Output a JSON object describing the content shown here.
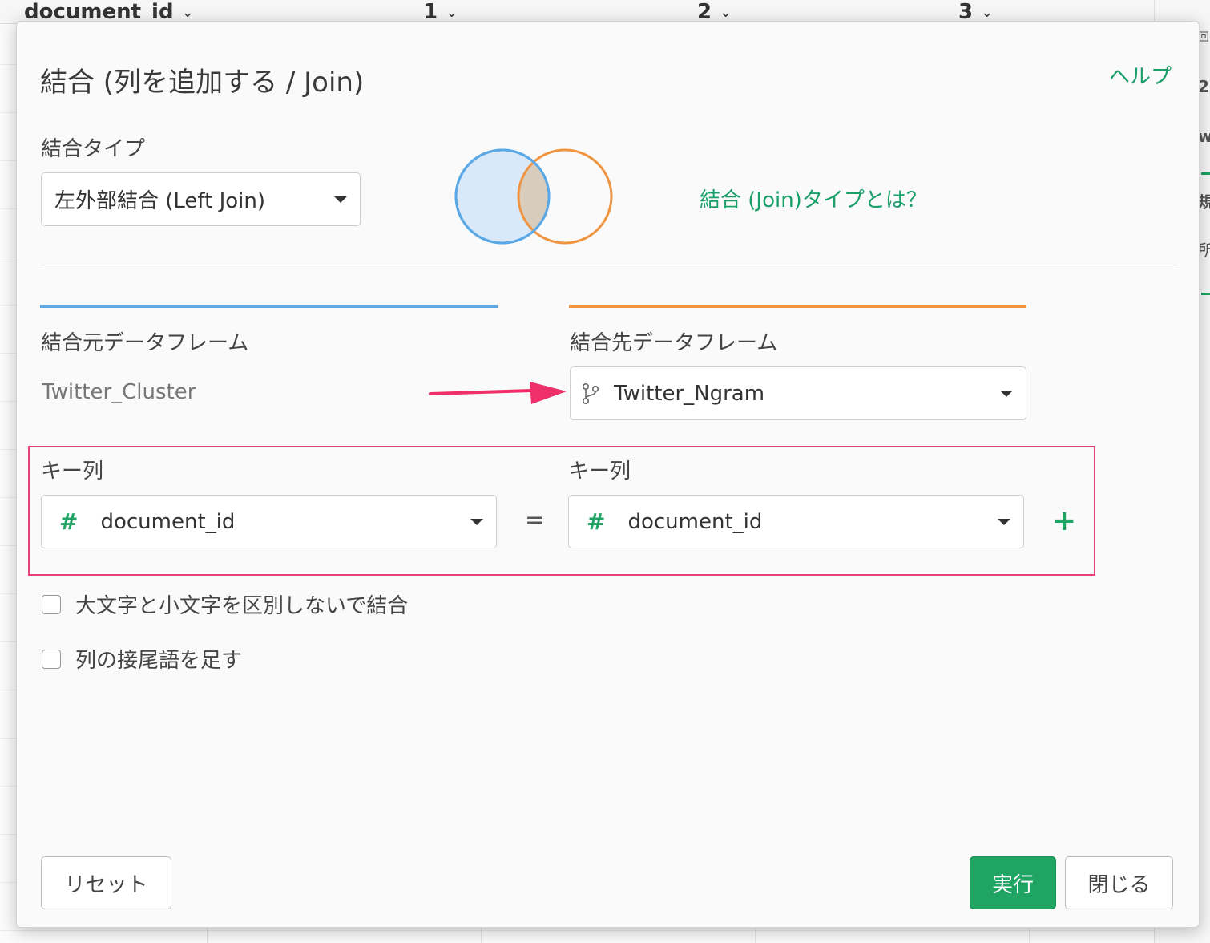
{
  "background": {
    "columns": [
      {
        "label": "document_id"
      },
      {
        "label": "1"
      },
      {
        "label": "2"
      },
      {
        "label": "3"
      }
    ],
    "side_glyphs": [
      "回",
      "2.",
      "w",
      "規",
      "所"
    ]
  },
  "dialog": {
    "title": "結合 (列を追加する / Join)",
    "help_label": "ヘルプ",
    "join_type": {
      "label": "結合タイプ",
      "selected": "左外部結合 (Left Join)",
      "what_is_link": "結合 (Join)タイプとは？",
      "venn_colors": {
        "left": "#5aa9e6",
        "right": "#ef9440"
      }
    },
    "source": {
      "label": "結合元データフレーム",
      "value": "Twitter_Cluster",
      "color": "#5aa9e6"
    },
    "target": {
      "label": "結合先データフレーム",
      "selected": "Twitter_Ngram",
      "icon": "branch-icon",
      "color": "#ef9440"
    },
    "keys": {
      "left_label": "キー列",
      "right_label": "キー列",
      "left_value": "document_id",
      "right_value": "document_id",
      "type_icon": "#",
      "equals": "=",
      "add_symbol": "+"
    },
    "options": {
      "ignore_case": "大文字と小文字を区別しないで結合",
      "add_suffix": "列の接尾語を足す"
    },
    "buttons": {
      "reset": "リセット",
      "run": "実行",
      "close": "閉じる"
    }
  },
  "colors": {
    "accent_green": "#1fa463",
    "highlight_pink": "#e8407a",
    "arrow_pink": "#ee2f6a"
  }
}
